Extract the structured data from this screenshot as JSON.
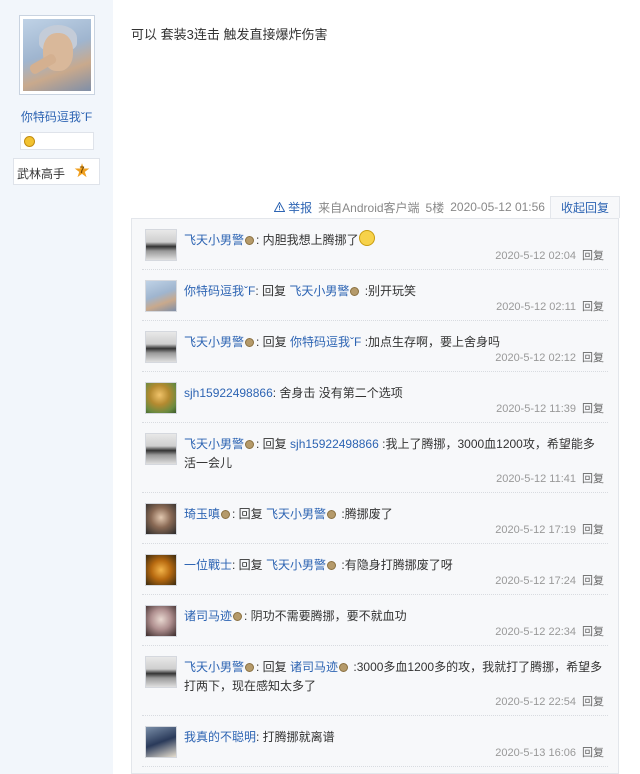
{
  "author": {
    "name": "你特码逗我ˇF",
    "badge_title": "武林高手",
    "badge_level": "7"
  },
  "post": {
    "content": "可以 套装3连击 触发直接爆炸伤害",
    "tail": {
      "report": "举报",
      "source": "来自Android客户端",
      "floor": "5楼",
      "time": "2020-05-12 01:56",
      "toggle": "收起回复"
    }
  },
  "replies": [
    {
      "user": "飞天小男警",
      "user_icon": true,
      "reply_to": "",
      "reply_to_icon": false,
      "text": ": 内胆我想上腾挪了",
      "emoji": true,
      "time": "2020-5-12 02:04",
      "action": "回复",
      "avatar": "av1"
    },
    {
      "user": "你特码逗我ˇF",
      "user_icon": false,
      "reply_to": "飞天小男警",
      "reply_to_icon": true,
      "text": " :别开玩笑",
      "emoji": false,
      "time": "2020-5-12 02:11",
      "action": "回复",
      "avatar": "av2"
    },
    {
      "user": "飞天小男警",
      "user_icon": true,
      "reply_to": "你特码逗我ˇF",
      "reply_to_icon": false,
      "text": " :加点生存啊，要上舍身吗",
      "emoji": false,
      "time": "2020-5-12 02:12",
      "action": "回复",
      "avatar": "av1"
    },
    {
      "user": "sjh15922498866",
      "user_icon": false,
      "reply_to": "",
      "reply_to_icon": false,
      "text": ": 舍身击 没有第二个选项",
      "emoji": false,
      "time": "2020-5-12 11:39",
      "action": "回复",
      "avatar": "av3"
    },
    {
      "user": "飞天小男警",
      "user_icon": true,
      "reply_to": "sjh15922498866",
      "reply_to_icon": false,
      "text": " :我上了腾挪，3000血1200攻，希望能多活一会儿",
      "emoji": false,
      "time": "2020-5-12 11:41",
      "action": "回复",
      "avatar": "av1"
    },
    {
      "user": "琦玉嗔",
      "user_icon": true,
      "reply_to": "飞天小男警",
      "reply_to_icon": true,
      "text": " :腾挪废了",
      "emoji": false,
      "time": "2020-5-12 17:19",
      "action": "回复",
      "avatar": "av4"
    },
    {
      "user": "一位戰士",
      "user_icon": false,
      "reply_to": "飞天小男警",
      "reply_to_icon": true,
      "text": " :有隐身打腾挪废了呀",
      "emoji": false,
      "time": "2020-5-12 17:24",
      "action": "回复",
      "avatar": "av5"
    },
    {
      "user": "诸司马迹",
      "user_icon": true,
      "reply_to": "",
      "reply_to_icon": false,
      "text": ": 阴功不需要腾挪，要不就血功",
      "emoji": false,
      "time": "2020-5-12 22:34",
      "action": "回复",
      "avatar": "av6"
    },
    {
      "user": "飞天小男警",
      "user_icon": true,
      "reply_to": "诸司马迹",
      "reply_to_icon": true,
      "text": " :3000多血1200多的攻，我就打了腾挪，希望多打两下，现在感知太多了",
      "emoji": false,
      "time": "2020-5-12 22:54",
      "action": "回复",
      "avatar": "av1"
    },
    {
      "user": "我真的不聪明",
      "user_icon": false,
      "reply_to": "",
      "reply_to_icon": false,
      "text": ": 打腾挪就离谱",
      "emoji": false,
      "time": "2020-5-13 16:06",
      "action": "回复",
      "avatar": "av7"
    }
  ],
  "reply_word": "回复"
}
